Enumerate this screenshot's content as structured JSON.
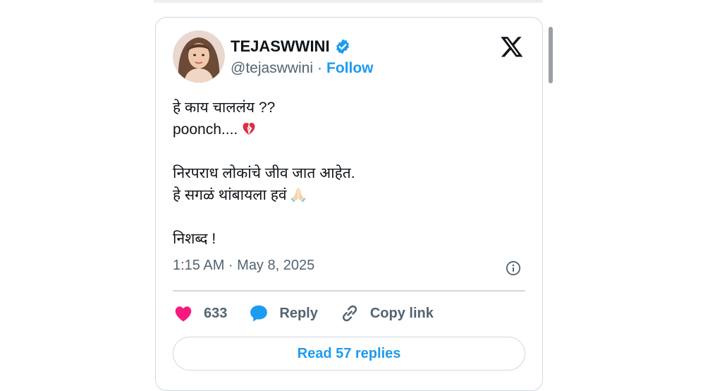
{
  "author": {
    "name": "TEJASWWINI",
    "handle": "@tejaswwini",
    "separator": "·",
    "follow_label": "Follow"
  },
  "tweet": {
    "lines": [
      "हे काय चाललंय ??",
      "poonch....",
      "",
      "निरपराध लोकांचे जीव जात आहेत.",
      "हे सगळं थांबायला हवं",
      "",
      "निशब्द !"
    ],
    "timestamp": "1:15 AM · May 8, 2025"
  },
  "actions": {
    "likes_count": "633",
    "reply_label": "Reply",
    "copy_link_label": "Copy link"
  },
  "read_replies_label": "Read 57 replies",
  "icons": [
    "verified-badge-icon",
    "x-logo-icon",
    "broken-heart-icon",
    "folded-hands-icon",
    "info-icon",
    "heart-icon",
    "reply-bubble-icon",
    "link-icon"
  ],
  "colors": {
    "accent": "#1d9bf0",
    "heart": "#f91880",
    "text": "#0f1419",
    "muted": "#536471",
    "border": "#cfd9de"
  }
}
